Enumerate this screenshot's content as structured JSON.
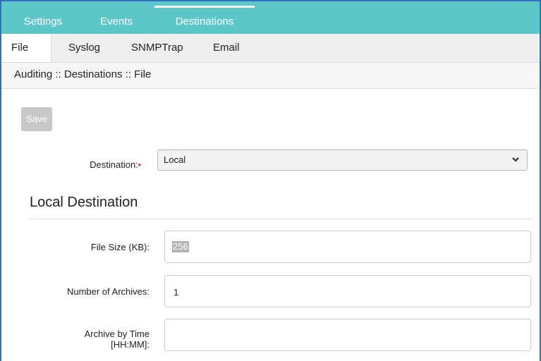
{
  "top_tabs": [
    {
      "label": "Settings"
    },
    {
      "label": "Events"
    },
    {
      "label": "Destinations",
      "active": true
    }
  ],
  "sub_tabs": [
    {
      "label": "File",
      "active": true
    },
    {
      "label": "Syslog"
    },
    {
      "label": "SNMPTrap"
    },
    {
      "label": "Email"
    }
  ],
  "breadcrumb": "Auditing :: Destinations :: File",
  "save_label": "Save",
  "destination": {
    "label": "Destination:",
    "required_marker": "•",
    "selected": "Local"
  },
  "section_title": "Local Destination",
  "fields": {
    "file_size": {
      "label": "File Size (KB):",
      "value": "256"
    },
    "num_archives": {
      "label": "Number of Archives:",
      "value": "1"
    },
    "archive_time": {
      "label_line1": "Archive by Time",
      "label_line2": "[HH:MM]:",
      "value": ""
    }
  },
  "colors": {
    "topnav_bg": "#5cc6c9",
    "frame": "#2f6fbe",
    "save_disabled": "#c8c8c8"
  },
  "icons": {
    "select_chevron": "chevron-down-icon"
  }
}
